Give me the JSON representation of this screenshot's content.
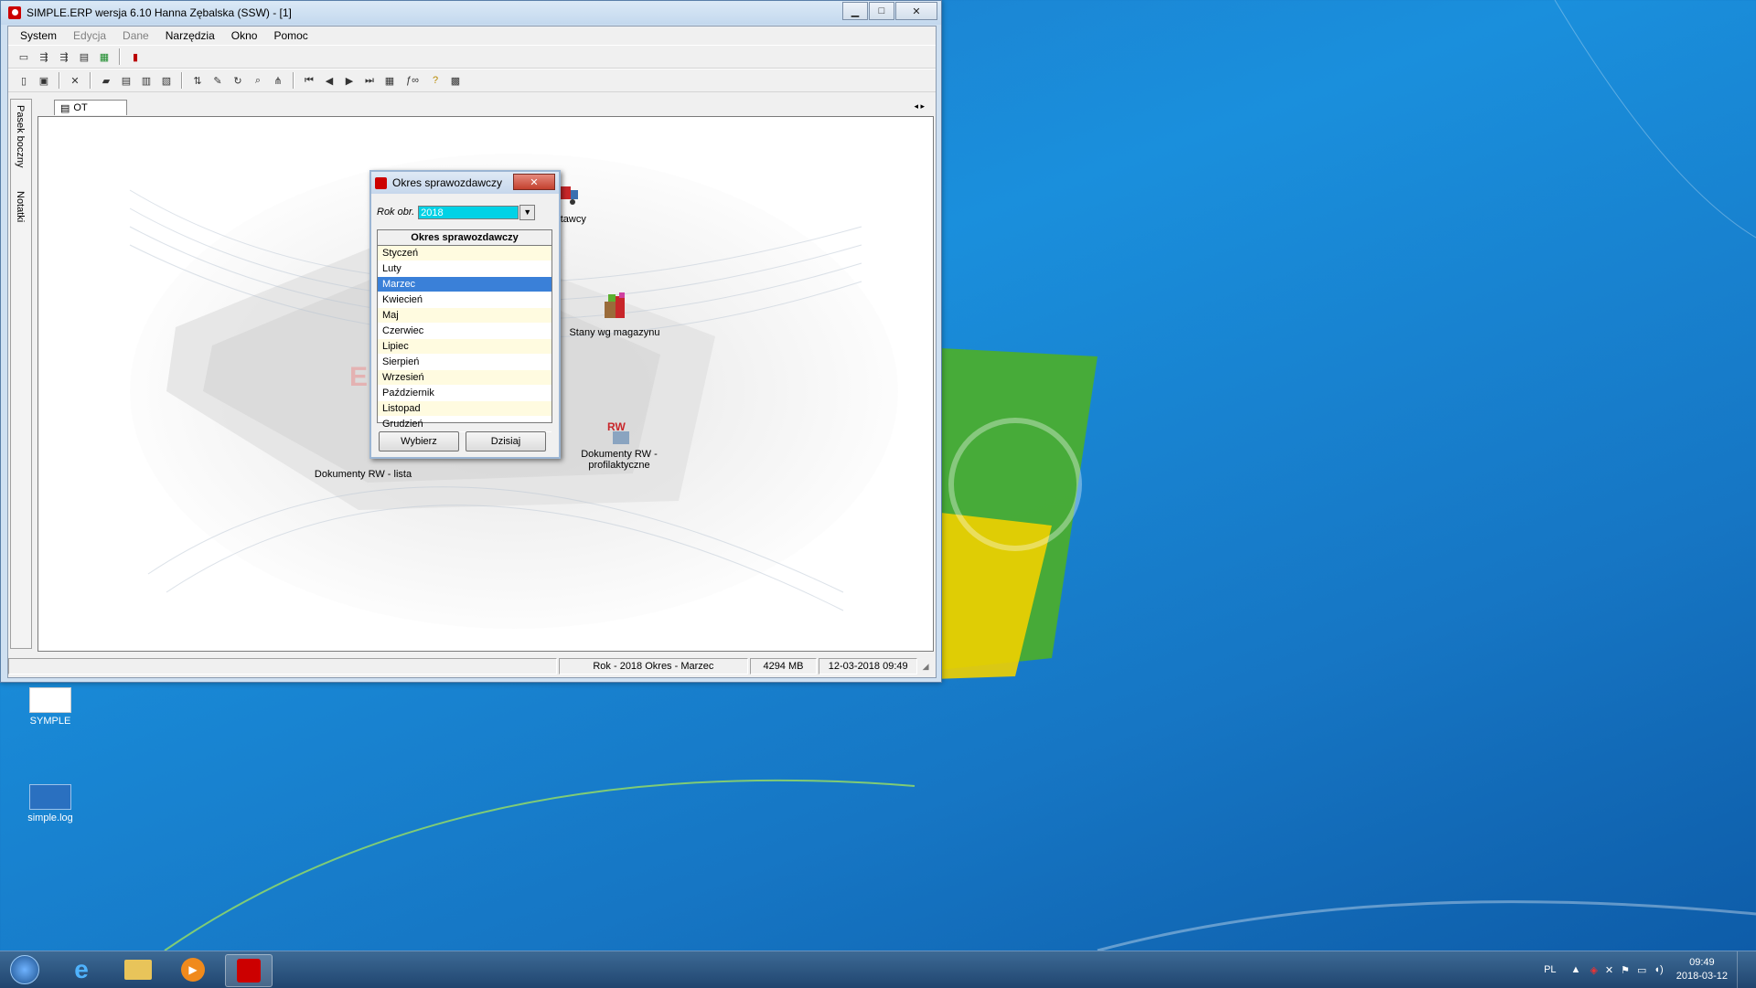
{
  "window": {
    "title": "SIMPLE.ERP wersja 6.10 Hanna Zębalska (SSW)  - [1]",
    "menu": [
      {
        "label": "System",
        "enabled": true
      },
      {
        "label": "Edycja",
        "enabled": false
      },
      {
        "label": "Dane",
        "enabled": false
      },
      {
        "label": "Narzędzia",
        "enabled": true
      },
      {
        "label": "Okno",
        "enabled": true
      },
      {
        "label": "Pomoc",
        "enabled": true
      }
    ],
    "sidebar_labels": [
      "Pasek boczny",
      "Notatki"
    ],
    "tab": "OT",
    "watermark": "ERP"
  },
  "shortcuts": {
    "dostawcy": "Dostawcy",
    "stany": "Stany wg magazynu",
    "rw_profil": "Dokumenty RW - profilaktyczne",
    "rw_profil_badge": "RW",
    "rw_lista": "Dokumenty RW - lista"
  },
  "dialog": {
    "title": "Okres sprawozdawczy",
    "rok_label": "Rok obr.",
    "rok_value": "2018",
    "list_header": "Okres sprawozdawczy",
    "months": [
      "Styczeń",
      "Luty",
      "Marzec",
      "Kwiecień",
      "Maj",
      "Czerwiec",
      "Lipiec",
      "Sierpień",
      "Wrzesień",
      "Październik",
      "Listopad",
      "Grudzień"
    ],
    "selected_index": 2,
    "btn_select": "Wybierz",
    "btn_today": "Dzisiaj"
  },
  "statusbar": {
    "period": "Rok - 2018 Okres - Marzec",
    "memory": "4294 MB",
    "datetime": "12-03-2018 09:49"
  },
  "desktop": {
    "icon1": "SYMPLE",
    "icon2": "simple.log"
  },
  "taskbar": {
    "lang": "PL",
    "time": "09:49",
    "date": "2018-03-12"
  }
}
